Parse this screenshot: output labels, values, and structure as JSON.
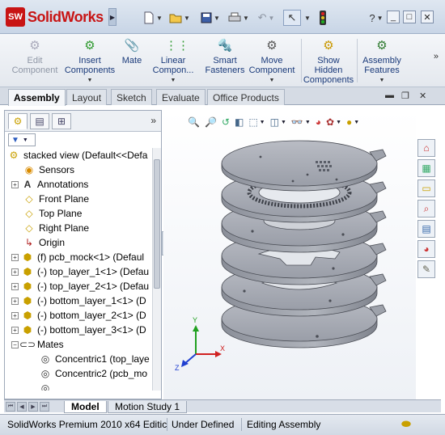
{
  "app": {
    "logo_text": "SolidWorks",
    "logo_mark": "SW"
  },
  "titlebar_buttons": {
    "new": "new-document-icon",
    "open": "open-icon",
    "save": "save-icon",
    "print": "print-icon",
    "undo": "undo-icon",
    "select": "select-arrow-icon",
    "rebuild": "rebuild-traffic-light-icon",
    "help_label": "?",
    "minimize": "_",
    "maximize": "□",
    "close": "✕"
  },
  "command_manager": {
    "buttons": [
      {
        "label_line1": "Edit",
        "label_line2": "Component",
        "icon": "edit-component-icon",
        "disabled": true
      },
      {
        "label_line1": "Insert",
        "label_line2": "Components",
        "icon": "insert-components-icon"
      },
      {
        "label_line1": "Mate",
        "label_line2": "",
        "icon": "mate-paperclip-icon"
      },
      {
        "label_line1": "Linear",
        "label_line2": "Compon...",
        "icon": "linear-pattern-icon"
      },
      {
        "label_line1": "Smart",
        "label_line2": "Fasteners",
        "icon": "smart-fasteners-icon"
      },
      {
        "label_line1": "Move",
        "label_line2": "Component",
        "icon": "move-component-icon"
      },
      {
        "label_line1": "Show",
        "label_line2": "Hidden",
        "label_line3": "Components",
        "icon": "show-hidden-icon"
      },
      {
        "label_line1": "Assembly",
        "label_line2": "Features",
        "icon": "assembly-features-icon"
      }
    ],
    "more": "»"
  },
  "tabs": [
    "Assembly",
    "Layout",
    "Sketch",
    "Evaluate",
    "Office Products"
  ],
  "active_tab": "Assembly",
  "left_panel": {
    "tab_icons": [
      "feature-manager-icon",
      "property-manager-icon",
      "configuration-manager-icon"
    ],
    "expand": "»",
    "filter_icon": "filter-icon",
    "tree": [
      {
        "text": "stacked view  (Default<<Defa",
        "icon": "assembly-icon",
        "indent": 0,
        "toggle": ""
      },
      {
        "text": "Sensors",
        "icon": "sensors-icon",
        "indent": 1,
        "toggle": ""
      },
      {
        "text": "Annotations",
        "icon": "annotations-icon",
        "indent": 1,
        "toggle": "+"
      },
      {
        "text": "Front Plane",
        "icon": "plane-icon",
        "indent": 1,
        "toggle": ""
      },
      {
        "text": "Top Plane",
        "icon": "plane-icon",
        "indent": 1,
        "toggle": ""
      },
      {
        "text": "Right Plane",
        "icon": "plane-icon",
        "indent": 1,
        "toggle": ""
      },
      {
        "text": "Origin",
        "icon": "origin-icon",
        "indent": 1,
        "toggle": ""
      },
      {
        "text": "(f) pcb_mock<1> (Defaul",
        "icon": "part-icon",
        "indent": 1,
        "toggle": "+"
      },
      {
        "text": "(-) top_layer_1<1> (Defau",
        "icon": "part-icon",
        "indent": 1,
        "toggle": "+"
      },
      {
        "text": "(-) top_layer_2<1> (Defau",
        "icon": "part-icon",
        "indent": 1,
        "toggle": "+"
      },
      {
        "text": "(-) bottom_layer_1<1> (D",
        "icon": "part-icon",
        "indent": 1,
        "toggle": "+"
      },
      {
        "text": "(-) bottom_layer_2<1> (D",
        "icon": "part-icon",
        "indent": 1,
        "toggle": "+"
      },
      {
        "text": "(-) bottom_layer_3<1> (D",
        "icon": "part-icon",
        "indent": 1,
        "toggle": "+"
      },
      {
        "text": "Mates",
        "icon": "mates-icon",
        "indent": 1,
        "toggle": "−"
      },
      {
        "text": "Concentric1 (top_laye",
        "icon": "concentric-icon",
        "indent": 2,
        "toggle": ""
      },
      {
        "text": "Concentric2 (pcb_mo",
        "icon": "concentric-icon",
        "indent": 2,
        "toggle": ""
      }
    ]
  },
  "view_toolbar": {
    "icons": [
      "zoom-to-fit-icon",
      "zoom-to-area-icon",
      "previous-view-icon",
      "section-view-icon",
      "view-orientation-icon",
      "display-style-icon",
      "hide-show-items-icon",
      "edit-appearance-icon",
      "apply-scene-icon",
      "view-settings-icon"
    ]
  },
  "triad": {
    "x_label": "X",
    "y_label": "Y",
    "z_label": "Z"
  },
  "task_pane_icons": [
    "solidworks-resources-icon",
    "design-library-icon",
    "file-explorer-icon",
    "search-icon",
    "view-palette-icon",
    "appearances-icon",
    "custom-properties-icon"
  ],
  "bottom_tabs": [
    "Model",
    "Motion Study 1"
  ],
  "active_bottom_tab": "Model",
  "status_bar": {
    "product": "SolidWorks Premium 2010 x64 Editic",
    "state": "Under Defined",
    "mode": "Editing Assembly",
    "icon": "rebuild-status-icon"
  },
  "colors": {
    "brand_red": "#c81414",
    "part_fill": "#a9acb4",
    "part_edge": "#4b4e56",
    "link_blue": "#1a3a7a"
  }
}
